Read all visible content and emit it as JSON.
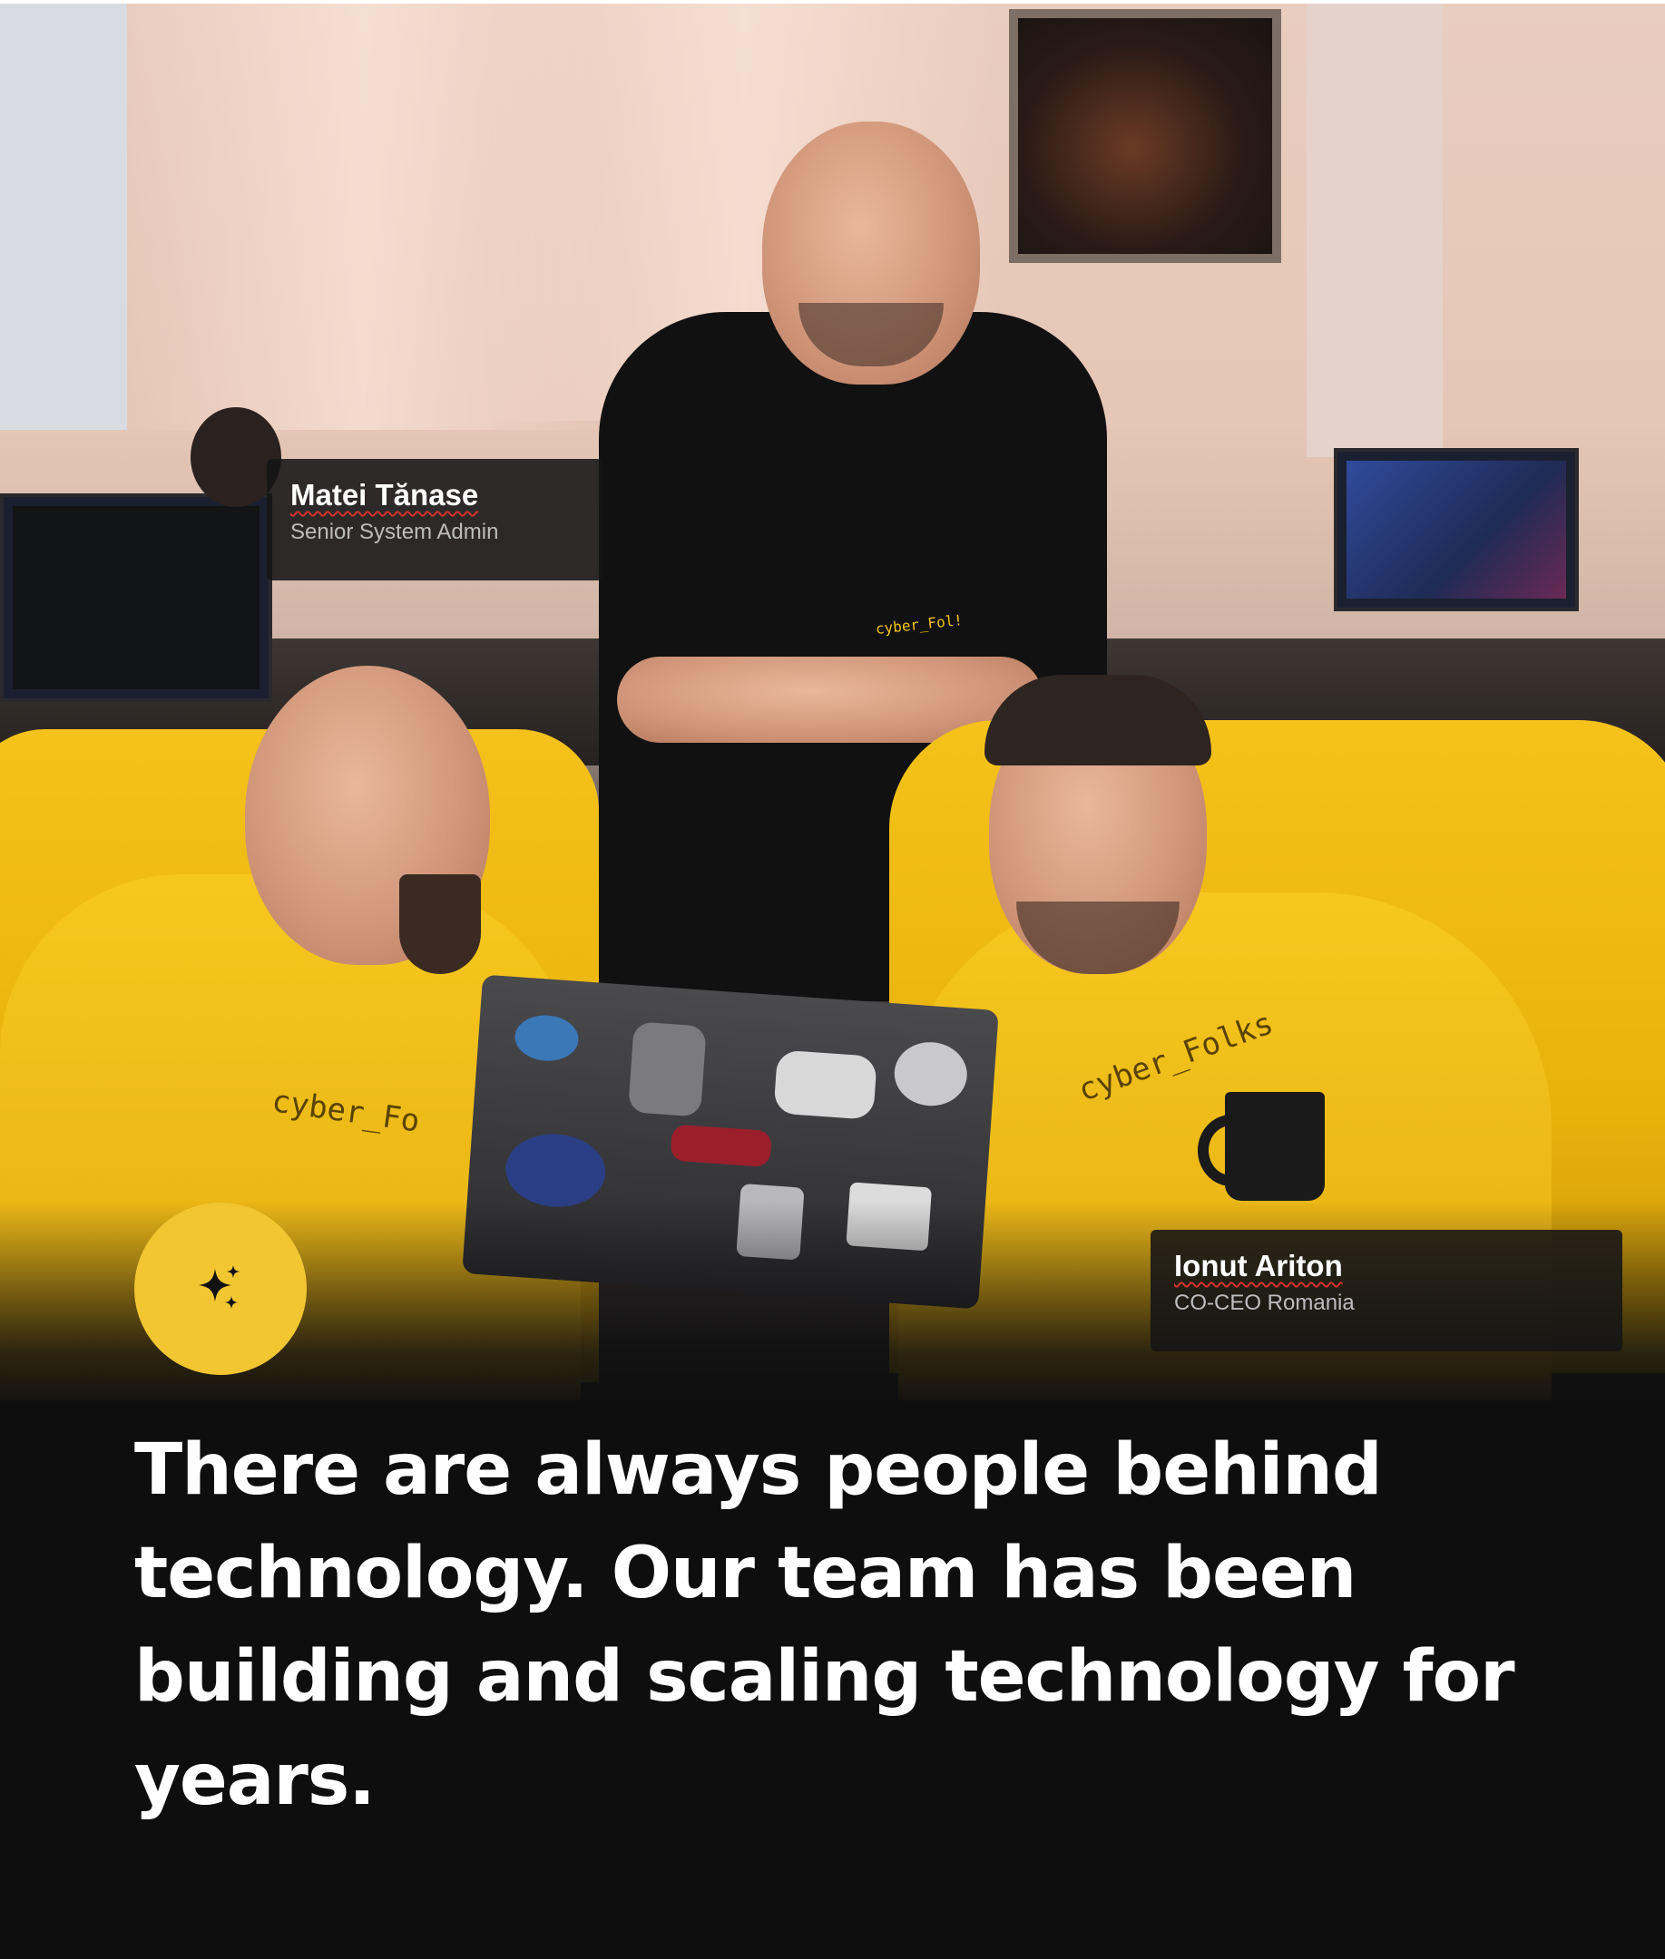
{
  "people": [
    {
      "name": "Matei Tănase",
      "role": "Senior System Admin"
    },
    {
      "name": "Ionut Ariton",
      "role": "CO-CEO Romania"
    }
  ],
  "shirt_prints": {
    "tshirt": "cyber_Fol!",
    "hoodie_left": "cyber_Fo",
    "hoodie_right": "cyber_Folks"
  },
  "badge": {
    "icon": "sparkles-icon"
  },
  "headline": "There are always people behind technology. Our team has been building and scaling technology for years.",
  "colors": {
    "background": "#0e0e0f",
    "accent_yellow": "#f1c631",
    "text": "#ffffff",
    "role_text": "#bdbdbd",
    "spellcheck_underline": "#d3322d"
  }
}
